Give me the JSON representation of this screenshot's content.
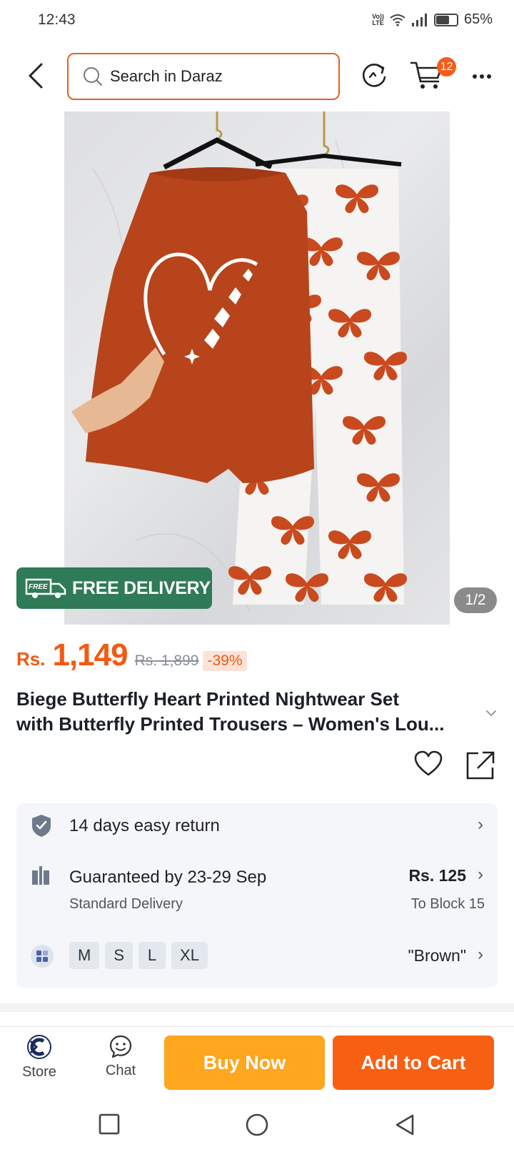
{
  "status_bar": {
    "time": "12:43",
    "volte_top": "Vo))",
    "volte_bottom": "LTE",
    "battery_level": 0.65,
    "battery_text": "65%"
  },
  "header": {
    "search_placeholder": "Search in Daraz",
    "cart_count": "12",
    "accent_color": "#e8621b"
  },
  "gallery": {
    "free_delivery_badge": "FREE",
    "free_delivery_label": "FREE DELIVERY",
    "counter": "1/2"
  },
  "price": {
    "currency": "Rs.",
    "current": "1,149",
    "original": "Rs. 1,899",
    "discount": "-39%"
  },
  "product": {
    "title_line1": "Biege Butterfly Heart  Printed Nightwear Set",
    "title_line2": "with Butterfly Printed Trousers – Women's Lou..."
  },
  "services": {
    "return_label": "14 days easy return",
    "delivery_label": "Guaranteed by 23-29 Sep",
    "delivery_type": "Standard Delivery",
    "delivery_price": "Rs. 125",
    "delivery_destination": "To Block 15",
    "sizes": [
      "M",
      "S",
      "L",
      "XL"
    ],
    "selected_color": "\"Brown\""
  },
  "action_bar": {
    "store_label": "Store",
    "chat_label": "Chat",
    "buy_now_label": "Buy Now",
    "add_to_cart_label": "Add to Cart",
    "buy_now_color": "#fda61e",
    "add_to_cart_color": "#f75f13"
  }
}
